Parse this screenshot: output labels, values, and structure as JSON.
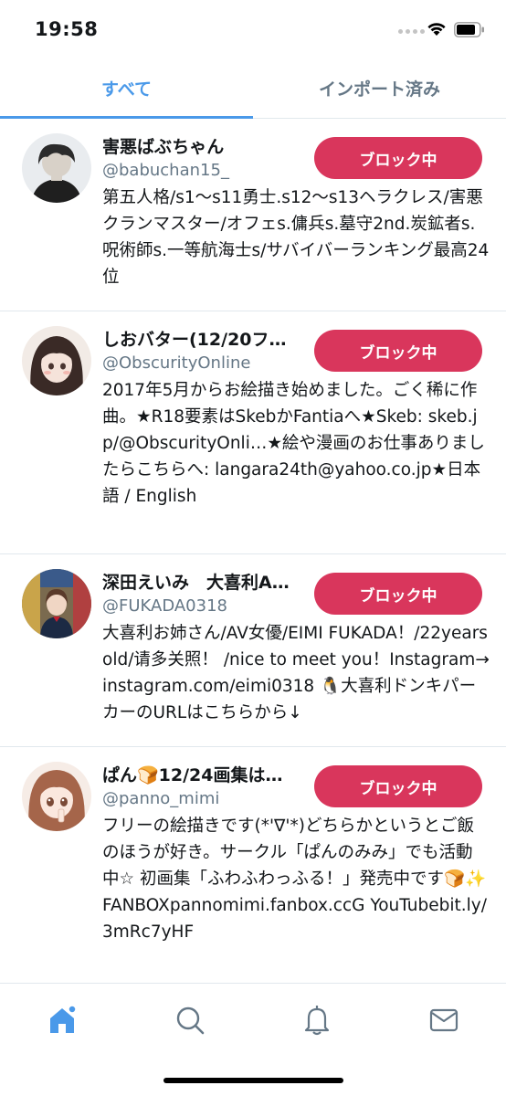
{
  "status_bar": {
    "time": "19:58"
  },
  "tabs": [
    {
      "label": "すべて",
      "active": true
    },
    {
      "label": "インポート済み",
      "active": false
    }
  ],
  "users": [
    {
      "name": "害悪ばぶちゃん",
      "handle": "@babuchan15_",
      "bio": "第五人格/s1〜s11勇士.s12〜s13ヘラクレス/害悪クランマスター/オフェs.傭兵s.墓守2nd.炭鉱者s.呪術師s.一等航海士s/サバイバーランキング最高24位",
      "button": "ブロック中"
    },
    {
      "name": "しおバター(12/20フ…",
      "handle": "@ObscurityOnline",
      "bio": "2017年5月からお絵描き始めました。ごく稀に作曲。★R18要素はSkebかFantiaへ★Skeb: skeb.jp/@ObscurityOnli…★絵や漫画のお仕事ありましたらこちらへ: langara24th@yahoo.co.jp★日本語 / English",
      "button": "ブロック中"
    },
    {
      "name": "深田えいみ　大喜利A…",
      "handle": "@FUKADA0318",
      "bio": "大喜利お姉さん/AV女優/EIMI FUKADA！/22years old/请多关照！ /nice to meet you！Instagram→instagram.com/eimi0318 🐧大喜利ドンキパーカーのURLはこちらから↓",
      "button": "ブロック中"
    },
    {
      "name": "ぱん🍞12/24画集は…",
      "handle": "@panno_mimi",
      "bio": "フリーの絵描きです(*'∇'*)どちらかというとご飯のほうが好き。サークル「ぱんのみみ」でも活動中☆ 初画集「ふわふわっふる！」発売中です🍞✨ FANBOXpannomimi.fanbox.ccG YouTubebit.ly/3mRc7yHF",
      "button": "ブロック中"
    }
  ],
  "nav": {
    "items": [
      "home-icon",
      "search-icon",
      "bell-icon",
      "mail-icon"
    ],
    "active_color": "#4a99e9",
    "inactive_color": "#657786"
  },
  "colors": {
    "accent": "#4a99e9",
    "block": "#d9365c"
  }
}
